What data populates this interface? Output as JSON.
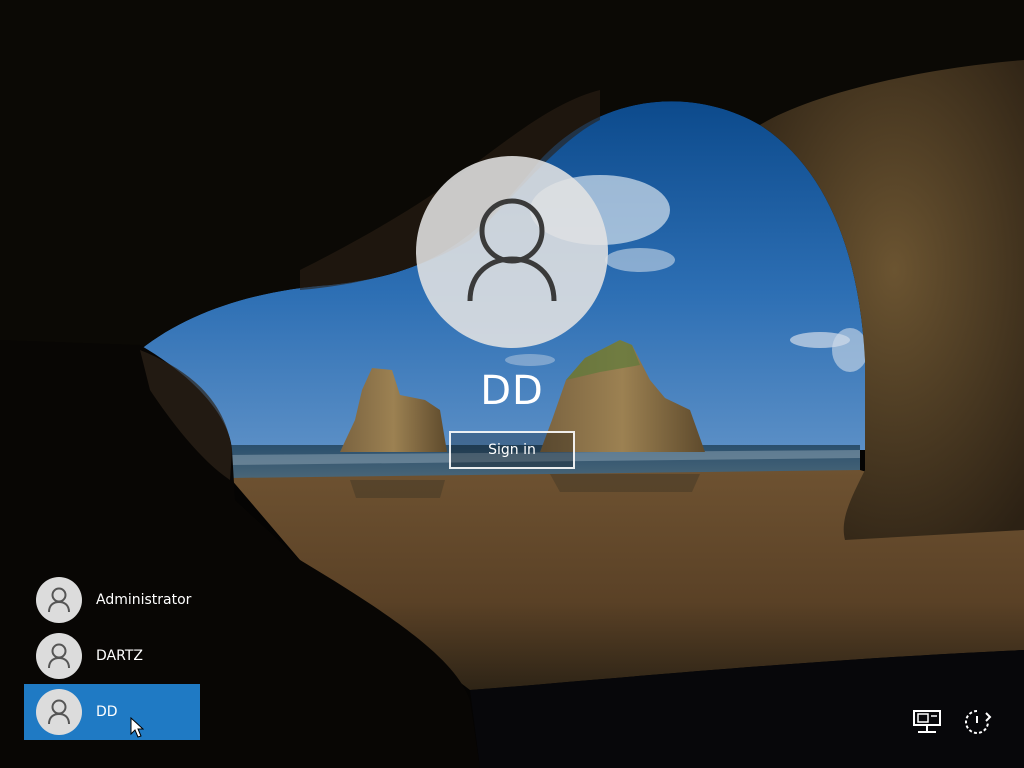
{
  "lockscreen": {
    "selected_user": "DD",
    "signin_label": "Sign in",
    "users": [
      {
        "name": "Administrator",
        "selected": false
      },
      {
        "name": "DARTZ",
        "selected": false
      },
      {
        "name": "DD",
        "selected": true
      }
    ]
  },
  "icons": {
    "avatar": "user-silhouette-icon",
    "network": "network-icon",
    "power": "power-icon",
    "cursor": "mouse-pointer-icon"
  },
  "colors": {
    "selected_tile": "#1f7ac4",
    "avatar_bg": "#e2e2e2",
    "text": "#ffffff"
  }
}
